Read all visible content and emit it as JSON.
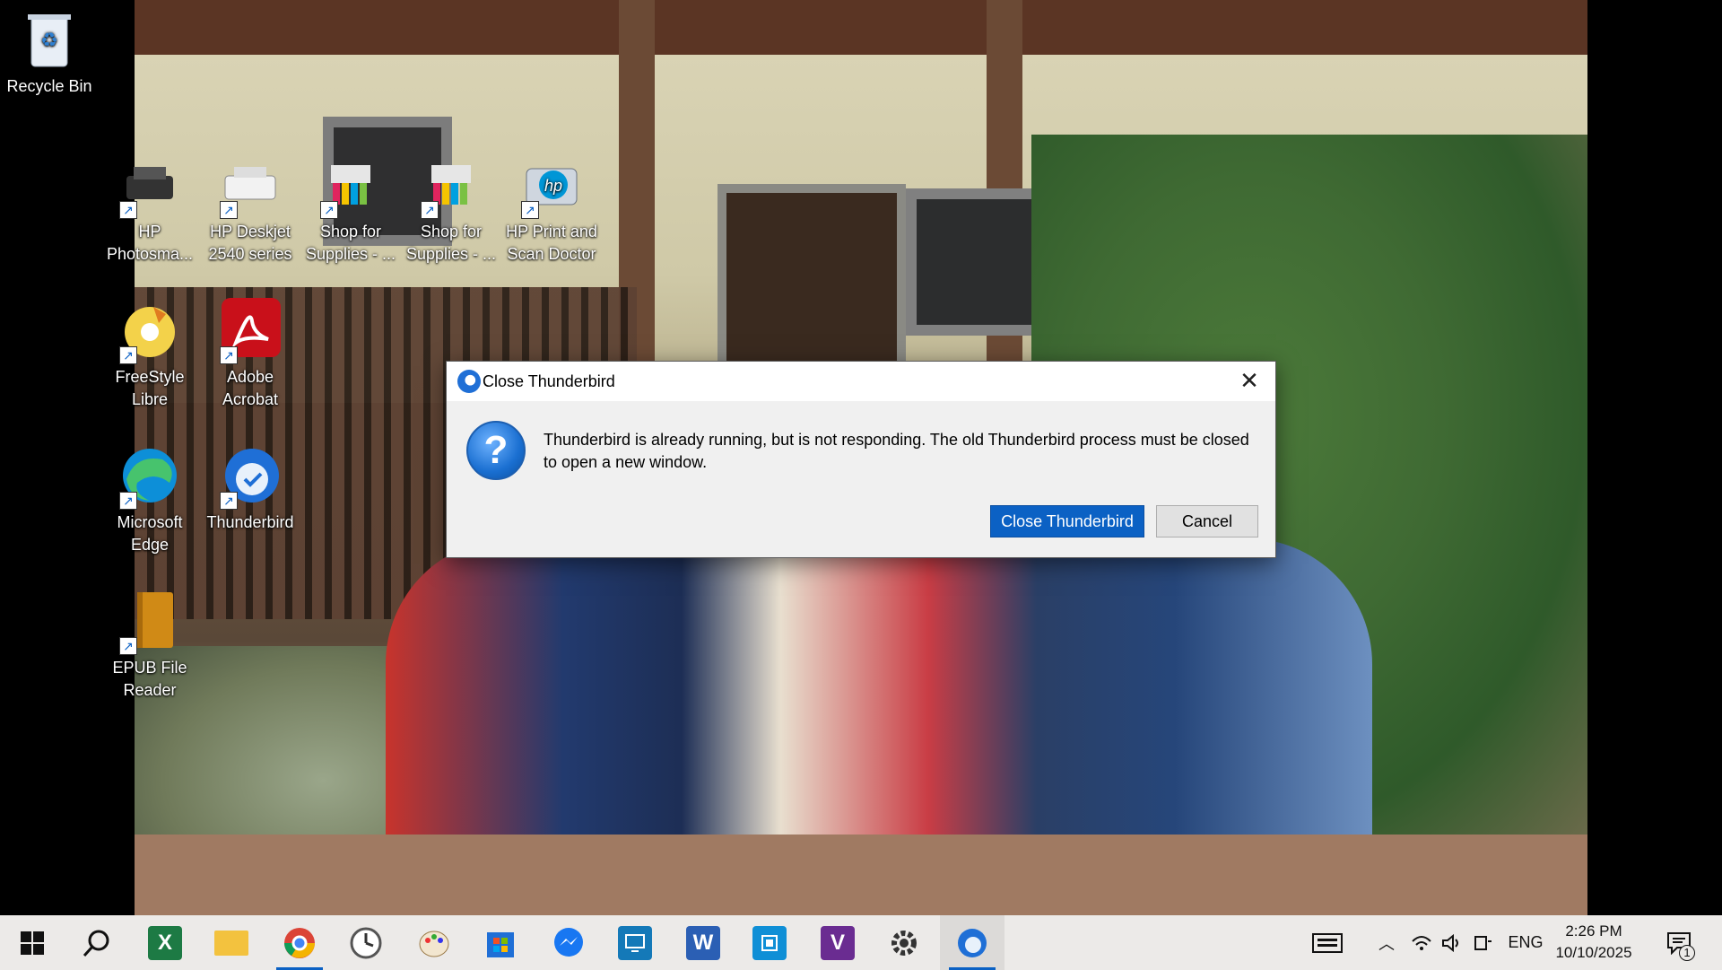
{
  "desktop": {
    "icons": [
      {
        "label": "Recycle Bin"
      },
      {
        "label": "HP Photosma..."
      },
      {
        "label": "HP Deskjet 2540 series"
      },
      {
        "label": "Shop for Supplies - ..."
      },
      {
        "label": "Shop for Supplies - ..."
      },
      {
        "label": "HP Print and Scan Doctor"
      },
      {
        "label": "FreeStyle Libre"
      },
      {
        "label": "Adobe Acrobat"
      },
      {
        "label": "Microsoft Edge"
      },
      {
        "label": "Thunderbird"
      },
      {
        "label": "EPUB File Reader"
      }
    ]
  },
  "dialog": {
    "title": "Close Thunderbird",
    "message": "Thunderbird is already running, but is not responding. The old Thunderbird process must be closed to open a new window.",
    "primary_button": "Close Thunderbird",
    "cancel_button": "Cancel",
    "close_glyph": "✕"
  },
  "taskbar": {
    "apps": [
      {
        "name": "start-button"
      },
      {
        "name": "search-icon"
      },
      {
        "name": "excel-icon",
        "glyph": "X"
      },
      {
        "name": "file-explorer-icon"
      },
      {
        "name": "chrome-icon"
      },
      {
        "name": "clock-app-icon"
      },
      {
        "name": "paint-icon"
      },
      {
        "name": "microsoft-store-icon"
      },
      {
        "name": "messenger-icon"
      },
      {
        "name": "remote-desktop-icon"
      },
      {
        "name": "word-icon",
        "glyph": "W"
      },
      {
        "name": "app-icon"
      },
      {
        "name": "v-app-icon",
        "glyph": "V"
      },
      {
        "name": "settings-icon"
      },
      {
        "name": "thunderbird-icon"
      }
    ],
    "tray": {
      "language": "ENG",
      "time": "2:26 PM",
      "date": "10/10/2025",
      "notification_count": "1"
    }
  },
  "colors": {
    "accent": "#0b61c4",
    "taskbar_bg": "#eceae8",
    "dialog_bg": "#f0f0f0"
  }
}
